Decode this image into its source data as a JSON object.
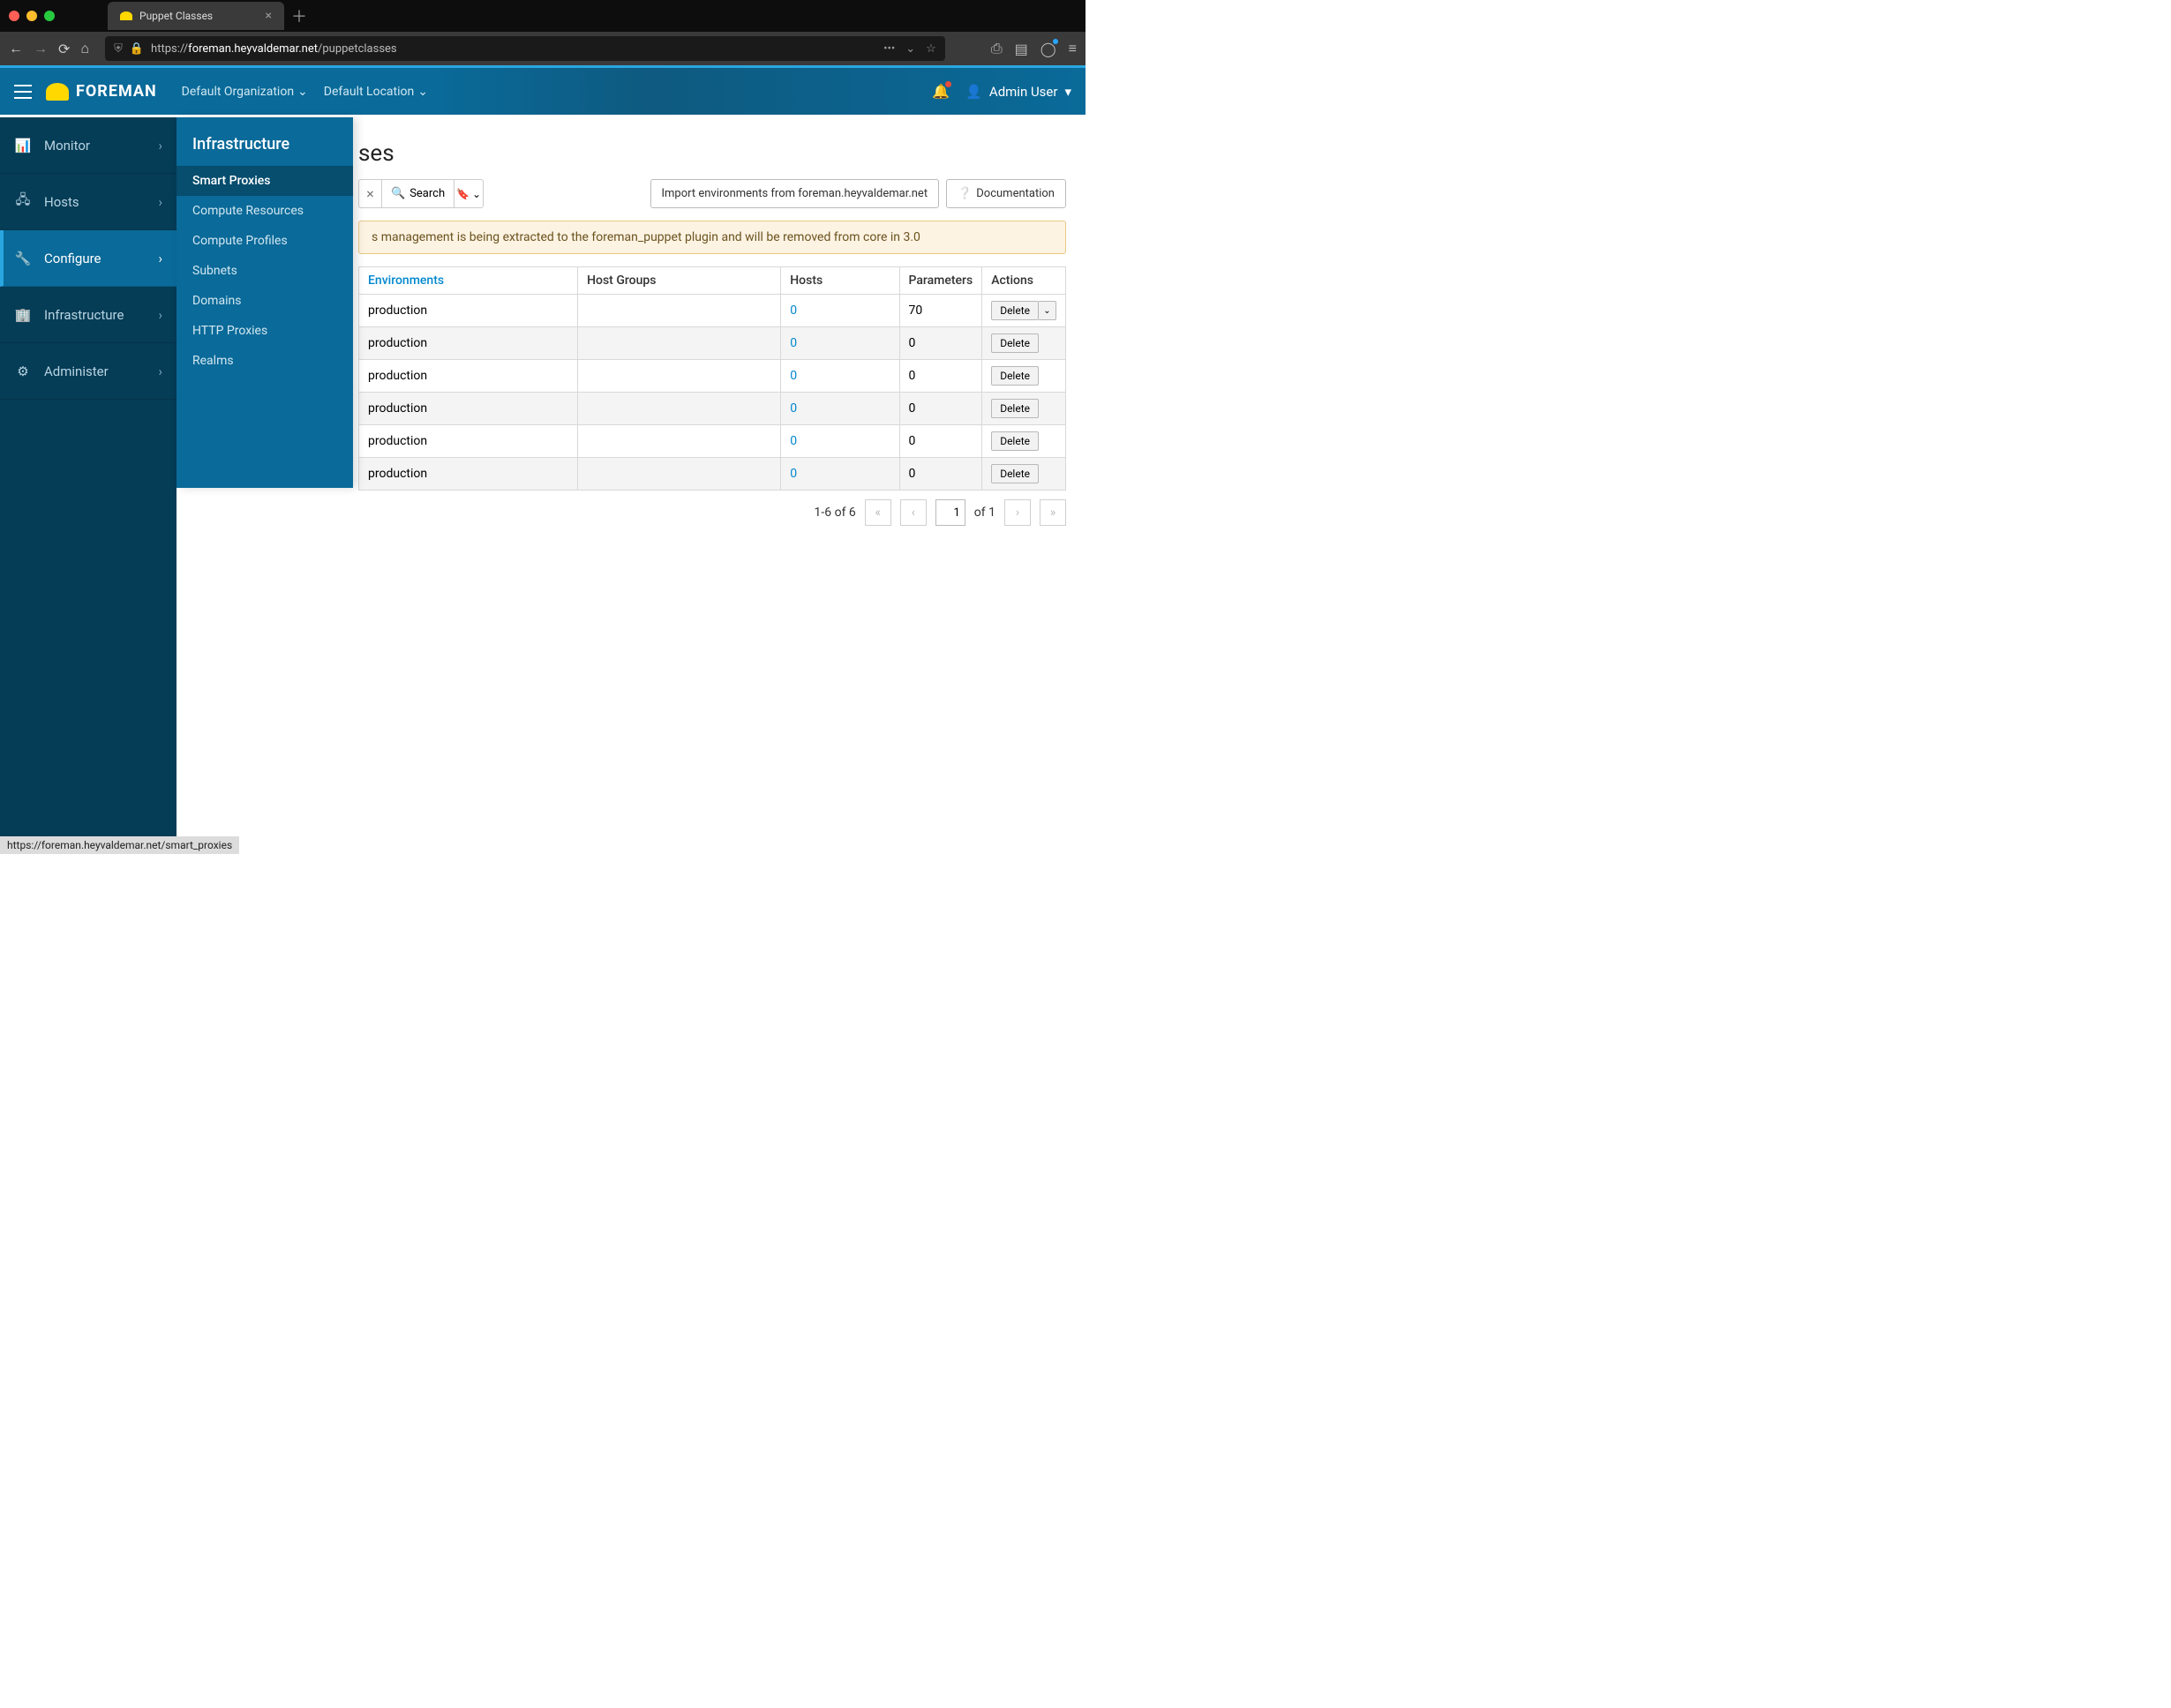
{
  "browser": {
    "tab_title": "Puppet Classes",
    "url_prefix": "https://",
    "url_domain": "foreman.heyvaldemar.net",
    "url_path": "/puppetclasses"
  },
  "header": {
    "brand": "FOREMAN",
    "org_selector": "Default Organization",
    "loc_selector": "Default Location",
    "user_name": "Admin User"
  },
  "sidebar": {
    "items": [
      {
        "label": "Monitor"
      },
      {
        "label": "Hosts"
      },
      {
        "label": "Configure"
      },
      {
        "label": "Infrastructure"
      },
      {
        "label": "Administer"
      }
    ]
  },
  "submenu": {
    "title": "Infrastructure",
    "items": [
      {
        "label": "Smart Proxies",
        "active": true
      },
      {
        "label": "Compute Resources"
      },
      {
        "label": "Compute Profiles"
      },
      {
        "label": "Subnets"
      },
      {
        "label": "Domains"
      },
      {
        "label": "HTTP Proxies"
      },
      {
        "label": "Realms"
      }
    ]
  },
  "page": {
    "title_fragment": "ses",
    "search_button": "Search",
    "import_button": "Import environments from foreman.heyvaldemar.net",
    "doc_button": "Documentation",
    "alert": "s management is being extracted to the foreman_puppet plugin and will be removed from core in 3.0"
  },
  "table": {
    "headers": {
      "environments": "Environments",
      "hostgroups": "Host Groups",
      "hosts": "Hosts",
      "parameters": "Parameters",
      "actions": "Actions"
    },
    "rows": [
      {
        "env": "production",
        "hosts": "0",
        "params": "70",
        "has_dropdown": true
      },
      {
        "env": "production",
        "hosts": "0",
        "params": "0"
      },
      {
        "env": "production",
        "hosts": "0",
        "params": "0"
      },
      {
        "env": "production",
        "hosts": "0",
        "params": "0"
      },
      {
        "env": "production",
        "hosts": "0",
        "params": "0"
      },
      {
        "env": "production",
        "hosts": "0",
        "params": "0"
      }
    ],
    "delete_label": "Delete"
  },
  "pagination": {
    "range": "1-6 of  6",
    "page_input": "1",
    "of_label": "of  1"
  },
  "status_bar": "https://foreman.heyvaldemar.net/smart_proxies"
}
